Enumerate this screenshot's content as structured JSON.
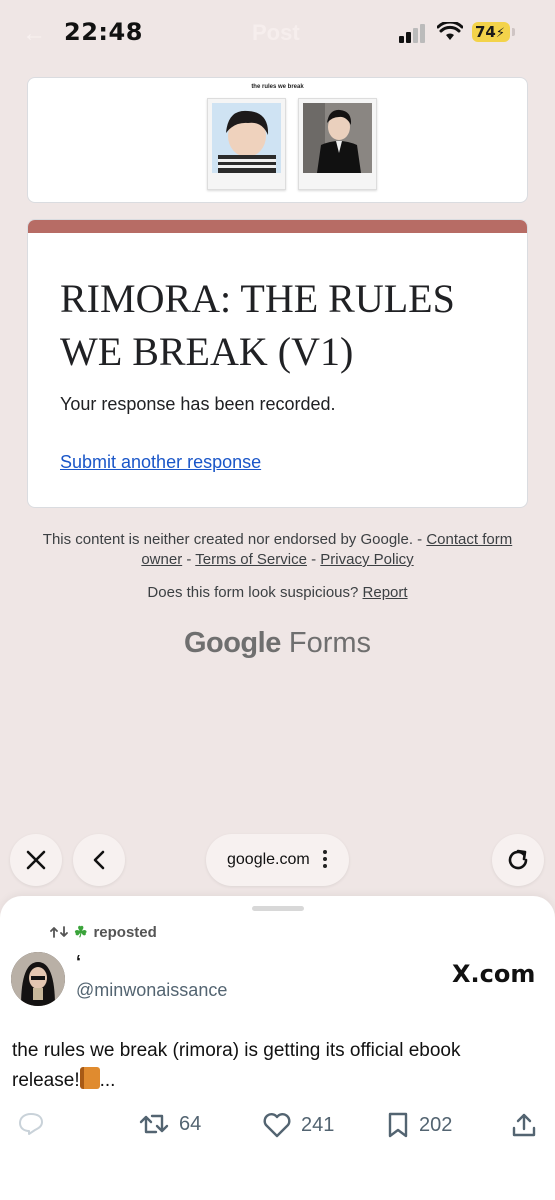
{
  "status": {
    "time": "22:48",
    "battery": "74",
    "ghost_title": "Post"
  },
  "header": {
    "caption": "the rules we break"
  },
  "form": {
    "title": "RIMORA: THE RULES WE BREAK (V1)",
    "message": "Your response has been recorded.",
    "link": "Submit another response",
    "accent_color": "#b76c65"
  },
  "footer": {
    "disclaimer": "This content is neither created nor endorsed by Google. -",
    "contact": "Contact form owner",
    "terms": "Terms of Service",
    "privacy": "Privacy Policy",
    "suspicious": "Does this form look suspicious?",
    "report": "Report",
    "brand_google": "Google",
    "brand_forms": "Forms"
  },
  "browser": {
    "url": "google.com"
  },
  "tweet": {
    "repost_label": "reposted",
    "display_name": "‘",
    "handle": "@minwonaissance",
    "source": "X.com",
    "text": "the rules we break (rimora) is getting its official ebook release!",
    "ellipsis": "...",
    "retweets": "64",
    "likes": "241",
    "bookmarks": "202"
  }
}
